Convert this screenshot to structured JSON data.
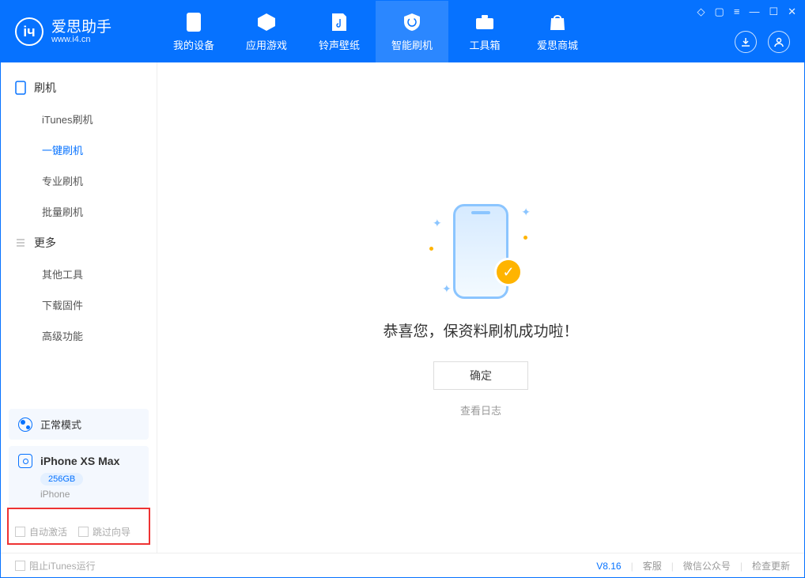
{
  "app": {
    "title": "爱思助手",
    "subtitle": "www.i4.cn"
  },
  "tabs": [
    {
      "label": "我的设备"
    },
    {
      "label": "应用游戏"
    },
    {
      "label": "铃声壁纸"
    },
    {
      "label": "智能刷机"
    },
    {
      "label": "工具箱"
    },
    {
      "label": "爱思商城"
    }
  ],
  "sidebar": {
    "group1": {
      "title": "刷机",
      "items": [
        "iTunes刷机",
        "一键刷机",
        "专业刷机",
        "批量刷机"
      ]
    },
    "group2": {
      "title": "更多",
      "items": [
        "其他工具",
        "下载固件",
        "高级功能"
      ]
    }
  },
  "mode": {
    "label": "正常模式"
  },
  "device": {
    "name": "iPhone XS Max",
    "storage": "256GB",
    "type": "iPhone"
  },
  "checks": {
    "auto_activate": "自动激活",
    "skip_guide": "跳过向导"
  },
  "main": {
    "message": "恭喜您，保资料刷机成功啦！",
    "ok": "确定",
    "view_log": "查看日志"
  },
  "footer": {
    "block_itunes": "阻止iTunes运行",
    "version": "V8.16",
    "support": "客服",
    "wechat": "微信公众号",
    "update": "检查更新"
  }
}
